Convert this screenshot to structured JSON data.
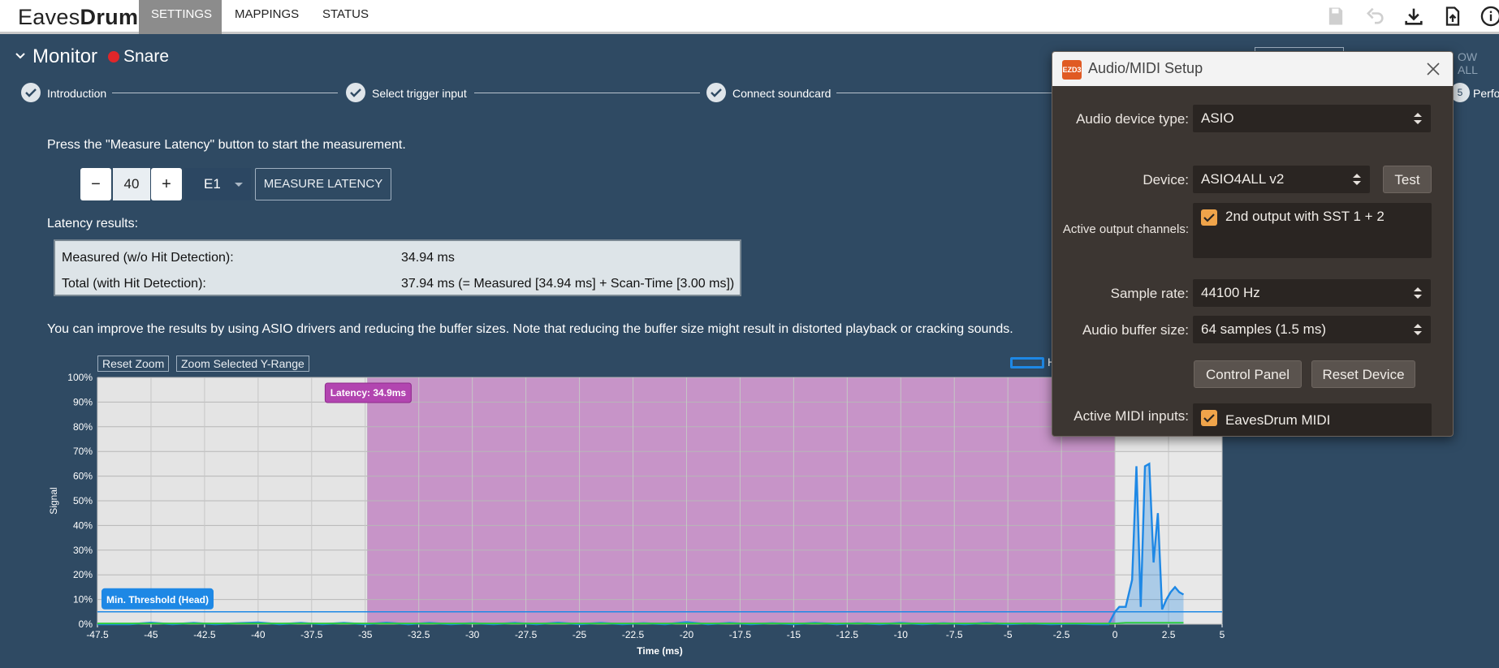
{
  "app": {
    "logo_part1": "Eaves",
    "logo_part2": "Drum",
    "tabs": [
      {
        "label": "SETTINGS"
      },
      {
        "label": "MAPPINGS"
      },
      {
        "label": "STATUS"
      }
    ],
    "toolbar_icons": [
      "save-icon",
      "undo-icon",
      "download-icon",
      "upload-icon",
      "info-icon"
    ]
  },
  "monitor": {
    "title": "Monitor",
    "instrument": "Snare",
    "steps": [
      {
        "label": "Introduction"
      },
      {
        "label": "Select trigger input"
      },
      {
        "label": "Connect soundcard"
      },
      {
        "label": "Perfo"
      }
    ],
    "step4_number": "5",
    "instruction": "Press the \"Measure Latency\" button to start the measurement.",
    "stepper": {
      "minus": "−",
      "value": "40",
      "plus": "+"
    },
    "note_select": "E1",
    "measure_button": "MEASURE LATENCY",
    "results_heading": "Latency results:",
    "results": [
      {
        "label": "Measured (w/o Hit Detection):",
        "value": "34.94 ms"
      },
      {
        "label": "Total (with Hit Detection):",
        "value": "37.94 ms (= Measured [34.94 ms] + Scan-Time [3.00 ms])"
      }
    ],
    "hint": "You can improve the results by using ASIO drivers and reducing the buffer sizes. Note that reducing the buffer size might result in distorted playback or cracking sounds.",
    "reset_zoom": "Reset Zoom",
    "zoom_y": "Zoom Selected Y-Range",
    "legend_partial": "H",
    "right_partial_text": "OW ALL"
  },
  "chart_data": {
    "type": "area",
    "xlabel": "Time (ms)",
    "ylabel": "Signal",
    "xlim": [
      -47.5,
      5
    ],
    "ylim": [
      0,
      100
    ],
    "x_ticks": [
      "-47.5",
      "-45",
      "-42.5",
      "-40",
      "-37.5",
      "-35",
      "-32.5",
      "-30",
      "-27.5",
      "-25",
      "-22.5",
      "-20",
      "-17.5",
      "-15",
      "-12.5",
      "-10",
      "-7.5",
      "-5",
      "-2.5",
      "0",
      "2.5",
      "5"
    ],
    "y_ticks": [
      "0%",
      "10%",
      "20%",
      "30%",
      "40%",
      "50%",
      "60%",
      "70%",
      "80%",
      "90%",
      "100%"
    ],
    "latency_band": {
      "from": -34.9,
      "to": 0,
      "label": "Latency: 34.9ms",
      "color": "#c794c8"
    },
    "threshold": {
      "value": 5,
      "label": "Min. Threshold (Head)",
      "color": "#1e88e5"
    },
    "series": [
      {
        "color": "#1e88e5",
        "x": [
          -47.5,
          -46,
          -45,
          -44,
          -43,
          -42,
          -41,
          -40,
          -39,
          -38,
          -37,
          -36,
          -35,
          -34,
          -33,
          -32,
          -31,
          -30,
          -29,
          -28,
          -27,
          -26,
          -25,
          -24,
          -23,
          -22,
          -21,
          -20,
          -19,
          -18,
          -17,
          -16,
          -15,
          -14,
          -13,
          -12,
          -11,
          -10,
          -9,
          -8,
          -7,
          -6,
          -5,
          -4,
          -3,
          -2,
          -1,
          -0.3,
          0,
          0.2,
          0.5,
          0.8,
          1.0,
          1.2,
          1.4,
          1.6,
          1.8,
          2.0,
          2.2,
          2.4,
          2.6,
          2.8,
          3.0,
          3.2
        ],
        "y": [
          0,
          0,
          0.6,
          0,
          0.5,
          0,
          0.4,
          0.7,
          0,
          0.5,
          0,
          0.5,
          0,
          0.6,
          0,
          0.5,
          0,
          0.4,
          0,
          0.5,
          0,
          0.6,
          0,
          0.5,
          0,
          0.4,
          0,
          0.8,
          0,
          0.5,
          0,
          0.4,
          0,
          0.5,
          0,
          0.4,
          0,
          0.5,
          0,
          0.4,
          0,
          0.5,
          0,
          0.3,
          0,
          0.2,
          0,
          0,
          5,
          7,
          7,
          18,
          64,
          7,
          64,
          65,
          25,
          45,
          6,
          10,
          13,
          15,
          13,
          12
        ]
      },
      {
        "color": "#2ecc40",
        "x": [
          -47.5,
          0,
          0.5,
          3.2
        ],
        "y": [
          0.3,
          0.3,
          0.6,
          0.6
        ]
      }
    ],
    "grid": true,
    "bg_before_band": "#e4e4e4",
    "bg_after_band": "#e8e8e8"
  },
  "dialog": {
    "title": "Audio/MIDI Setup",
    "logo_text": "EZD3",
    "audio_device_type_label": "Audio device type:",
    "audio_device_type": "ASIO",
    "device_label": "Device:",
    "device": "ASIO4ALL v2",
    "test_button": "Test",
    "active_output_label": "Active output channels:",
    "output_channel": "2nd output with SST 1 + 2",
    "sample_rate_label": "Sample rate:",
    "sample_rate": "44100 Hz",
    "buffer_label": "Audio buffer size:",
    "buffer": "64 samples (1.5 ms)",
    "control_panel_button": "Control Panel",
    "reset_device_button": "Reset Device",
    "midi_inputs_label": "Active MIDI inputs:",
    "midi_input": "EavesDrum MIDI"
  }
}
